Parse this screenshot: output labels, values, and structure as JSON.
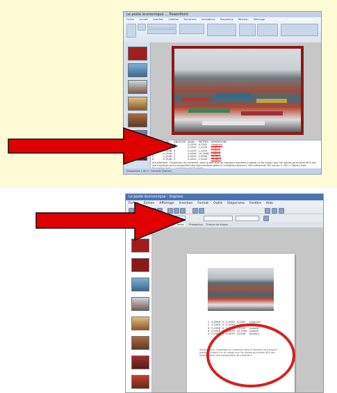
{
  "ppt": {
    "title": "Le poste économique ... PowerPoint",
    "tabs": [
      "Fichier",
      "Accueil",
      "Insertion",
      "Création",
      "Transitions",
      "Animations",
      "Diaporama",
      "Révision",
      "Affichage"
    ],
    "status": "Diapositive 1 de 9 · Français (France)",
    "notes_headers": [
      "PIECES",
      "poids",
      "ANALYSIS",
      "poids",
      "METRES",
      "DIMENSIONS"
    ],
    "notes_rows": [
      [
        "1",
        "2,5948",
        "0",
        "0,0259",
        "0,2592",
        "Longueur"
      ],
      [
        "2",
        "0,1948",
        "0",
        "0,0259",
        "1,0259",
        "Largeur"
      ],
      [
        "3",
        "0,1948",
        "0",
        "0,0259",
        "1,0259",
        "Largeur"
      ],
      [
        "4",
        "0,1948",
        "0",
        "0,0259",
        "10,2598",
        "Largeur"
      ],
      [
        "5",
        "0,1948",
        "0",
        "0,0259",
        "2,0596",
        "Hauteur"
      ],
      [
        "6",
        "0,1948",
        "0",
        "0,0259",
        "1,0245",
        "Hauteur"
      ]
    ],
    "notes_paragraph": "Actuellement, l'expansion du conteneur dans le domaine du transport maritime a abouti un tel niveau que l'on estime qu'environ 90% des marchandises sont transportées des marchandises grâce à l'utilisation diverse à 200 millions de TEU par an (1 TEU = Twenty-Foot Equivalent Unit = 1 conteneur de 20 pieds)."
  },
  "impress": {
    "title": "Le poste économique - Impress",
    "menu": [
      "Fichier",
      "Édition",
      "Affichage",
      "Insertion",
      "Format",
      "Outils",
      "Diaporama",
      "Fenêtre",
      "Aide"
    ],
    "view_tabs": [
      "Normal",
      "Plan",
      "Notes",
      "Prospectus",
      "Trieuse de diapos"
    ],
    "table_rows": [
      [
        "1",
        "0,2948",
        "0",
        "0,0259",
        "0,2592",
        "Longueur"
      ],
      [
        "2",
        "0,1948",
        "0",
        "0,0259",
        "1,0259",
        "Largeur"
      ],
      [
        "3",
        "0,1948",
        "0",
        "0,0259",
        "1,0259",
        "Largeur"
      ],
      [
        "4",
        "0,1948",
        "0",
        "0,0259",
        "10,2598",
        "Largeur"
      ],
      [
        "5",
        "0,1948",
        "0",
        "0,0259",
        "2,0596",
        "Hauteur"
      ]
    ],
    "paragraph": "Actuellement, l'expansion du conteneur dans le domaine du transport maritime a abouti un tel niveau que l'on estime qu'environ 90% des marchandises sont transportées par conteneur."
  },
  "colors": {
    "arrow": "#e00000",
    "highlight": "#d71e1e",
    "top_panel_bg": "#fefbd6"
  }
}
